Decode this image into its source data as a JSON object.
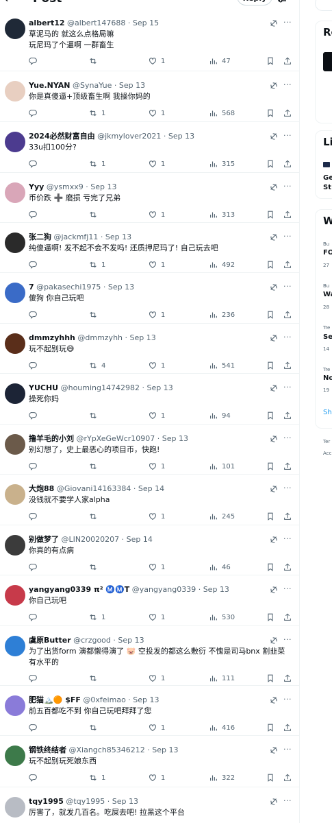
{
  "header": {
    "title": "Post",
    "reply_label": "Reply",
    "back_icon": "arrow-left-icon",
    "settings_icon": "sliders-icon"
  },
  "tweets": [
    {
      "name": "albert12",
      "handle": "@albert147688",
      "date": "Sep 15",
      "text": "草泥马的 就这么点格局嘛\n玩尼玛了个逼啊 一群畜生",
      "retweets": "",
      "likes": "1",
      "views": "47",
      "avatar_color": "#1f2937"
    },
    {
      "name": "Yue.NYAN",
      "handle": "@SynaYue",
      "date": "Sep 13",
      "text": "你是真傻逼+顶级畜生啊 我操你妈的",
      "retweets": "1",
      "likes": "1",
      "views": "568",
      "avatar_color": "#e8cfc1"
    },
    {
      "name": "2024必然财富自由",
      "handle": "@jkmylover2021",
      "date": "Sep 13",
      "text": "33u扣100分?",
      "retweets": "1",
      "likes": "1",
      "views": "315",
      "avatar_color": "#4c3b8f"
    },
    {
      "name": "Yyy",
      "handle": "@ysmxx9",
      "date": "Sep 13",
      "text": "币价跌 ➕ 磨损 亏完了兄弟",
      "retweets": "",
      "likes": "1",
      "views": "313",
      "avatar_color": "#d9a6b8"
    },
    {
      "name": "张二狗",
      "handle": "@jackmfj11",
      "date": "Sep 13",
      "text": "纯傻逼啊! 发不起不会不发吗! 还质押尼玛了! 自己玩去吧",
      "retweets": "1",
      "likes": "1",
      "views": "492",
      "avatar_color": "#2a2a2a"
    },
    {
      "name": "7",
      "handle": "@pakasechi1975",
      "date": "Sep 13",
      "text": "傻狗 你自己玩吧",
      "retweets": "",
      "likes": "1",
      "views": "236",
      "avatar_color": "#3a6bc7"
    },
    {
      "name": "dmmzyhhh",
      "handle": "@dmmzyhh",
      "date": "Sep 13",
      "text": "玩不起别玩😅",
      "retweets": "4",
      "likes": "1",
      "views": "541",
      "avatar_color": "#5a2e1a"
    },
    {
      "name": "YUCHU",
      "handle": "@houming14742982",
      "date": "Sep 13",
      "text": "操死你妈",
      "retweets": "",
      "likes": "1",
      "views": "94",
      "avatar_color": "#1c2436"
    },
    {
      "name": "撸羊毛的小刘",
      "handle": "@rYpXeGeWcr10907",
      "date": "Sep 13",
      "text": "别幻想了，史上最恶心的项目币，快跑!",
      "retweets": "",
      "likes": "1",
      "views": "101",
      "avatar_color": "#6b5a4a"
    },
    {
      "name": "大炮88",
      "handle": "@Giovani14163384",
      "date": "Sep 14",
      "text": "没钱就不要学人家alpha",
      "retweets": "",
      "likes": "1",
      "views": "245",
      "avatar_color": "#c9b18c"
    },
    {
      "name": "别做梦了",
      "handle": "@LIN20020207",
      "date": "Sep 14",
      "text": "你真的有点病",
      "retweets": "",
      "likes": "1",
      "views": "46",
      "avatar_color": "#3b3b3b"
    },
    {
      "name": "yangyang0339 π² Ⓜ️Ⓜ️T",
      "handle": "@yangyang0339",
      "date": "Sep 13",
      "text": "你自己玩吧",
      "retweets": "1",
      "likes": "1",
      "views": "530",
      "avatar_color": "#c73a4a"
    },
    {
      "name": "虞原Butter",
      "handle": "@crzgood",
      "date": "Sep 13",
      "text": "为了出货form 演都懒得演了 🐷 空投发的都这么敷衍 不愧是司马bnx 割韭菜有水平的",
      "retweets": "",
      "likes": "1",
      "views": "111",
      "avatar_color": "#2e7fd6"
    },
    {
      "name": "肥猫🏔️🟠 $FF",
      "handle": "@0xfeimao",
      "date": "Sep 13",
      "text": "前五百都吃不到 你自己玩吧拜拜了您",
      "retweets": "",
      "likes": "1",
      "views": "416",
      "avatar_color": "#8a7bd9"
    },
    {
      "name": "钢铁终结者",
      "handle": "@Xiangch85346212",
      "date": "Sep 13",
      "text": "玩不起别玩死娘东西",
      "retweets": "1",
      "likes": "1",
      "views": "322",
      "avatar_color": "#3d7a4a"
    },
    {
      "name": "tqy1995",
      "handle": "@tqy1995",
      "date": "Sep 13",
      "text": "厉害了，就发几百名。吃屎去吧! 拉黑这个平台",
      "retweets": "",
      "likes": "",
      "views": "",
      "avatar_color": "#b8bcc4"
    }
  ],
  "right": {
    "card1_title": "Re",
    "card2_title": "Li",
    "card2_lines": [
      "Ge",
      "St"
    ],
    "card3_title": "W",
    "trends": [
      {
        "cat": "Bu",
        "name": "FO",
        "count": "27"
      },
      {
        "cat": "Bu",
        "name": "Wa",
        "count": "28"
      },
      {
        "cat": "Tre",
        "name": "Se",
        "count": "14"
      },
      {
        "cat": "Tre",
        "name": "No",
        "count": "19"
      }
    ],
    "show_more": "Sh",
    "footer1": "Ter",
    "footer2": "Acc"
  },
  "colors": {
    "text": "#0f1419",
    "muted": "#536471",
    "accent": "#1d9bf0",
    "divider": "#eff3f4"
  }
}
